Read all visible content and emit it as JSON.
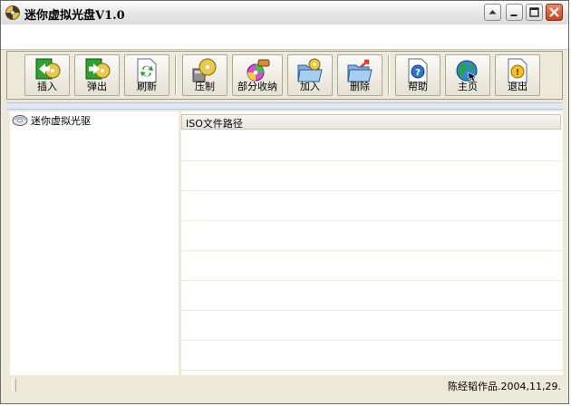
{
  "window": {
    "title": "迷你虚拟光盘V1.0"
  },
  "toolbar": {
    "buttons": [
      {
        "label": "插入",
        "icon": "insert-disc-icon"
      },
      {
        "label": "弹出",
        "icon": "eject-disc-icon"
      },
      {
        "label": "刷新",
        "icon": "refresh-icon"
      },
      {
        "label": "压制",
        "icon": "compress-disc-icon"
      },
      {
        "label": "部分收纳",
        "icon": "partial-store-icon"
      },
      {
        "label": "加入",
        "icon": "add-folder-icon"
      },
      {
        "label": "删除",
        "icon": "delete-folder-icon"
      },
      {
        "label": "帮助",
        "icon": "help-icon"
      },
      {
        "label": "主页",
        "icon": "homepage-globe-icon"
      },
      {
        "label": "退出",
        "icon": "exit-icon"
      }
    ]
  },
  "tree": {
    "root_label": "迷你虚拟光驱"
  },
  "list": {
    "column_header": "ISO文件路径"
  },
  "statusbar": {
    "text": "陈经韬作品.2004,11,29."
  },
  "colors": {
    "window_bg": "#ece9d8",
    "border": "#6b6b6b",
    "close_button": "#c9401e"
  }
}
